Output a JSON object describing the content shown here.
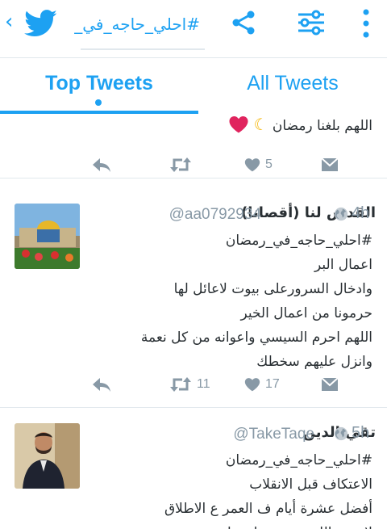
{
  "header": {
    "search_query": "#احلي_حاجه_في_",
    "icons": [
      "back-chevron-icon",
      "twitter-bird-icon",
      "share-icon",
      "filter-icon",
      "overflow-menu-icon"
    ]
  },
  "tabs": [
    {
      "label": "Top Tweets",
      "active": true
    },
    {
      "label": "All Tweets",
      "active": false
    }
  ],
  "colors": {
    "accent": "#1da1f2",
    "muted": "#8899a6",
    "text": "#292f33",
    "heart": "#e0245e",
    "moon": "#f5b70a"
  },
  "tweets": [
    {
      "lines": [
        "اللهم بلغنا رمضان"
      ],
      "emoji": [
        "crescent-moon-icon",
        "red-heart-icon"
      ],
      "retweets": "",
      "likes": "5"
    },
    {
      "name": "القدس لنا (أقصانا)",
      "handle": "@aa0792934",
      "time": "4h",
      "lines": [
        "#احلي_حاجه_في_رمضان",
        "اعمال البر",
        "وادخال السرورعلى بيوت لاعائل لها",
        "حرمونا من اعمال الخير",
        "اللهم احرم السيسي واعوانه من كل نعمة",
        "وانزل عليهم سخطك"
      ],
      "retweets": "11",
      "likes": "17"
    },
    {
      "name": "تقي الدين",
      "handle": "@TakeTaqe",
      "time": "5h",
      "lines": [
        "#احلي_حاجه_في_رمضان",
        "الاعتكاف قبل الانقلاب",
        "أفضل عشرة أيام ف العمر ع الاطلاق",
        "لا رحم الله من حرمنا منها"
      ],
      "retweets": "",
      "likes": ""
    }
  ]
}
